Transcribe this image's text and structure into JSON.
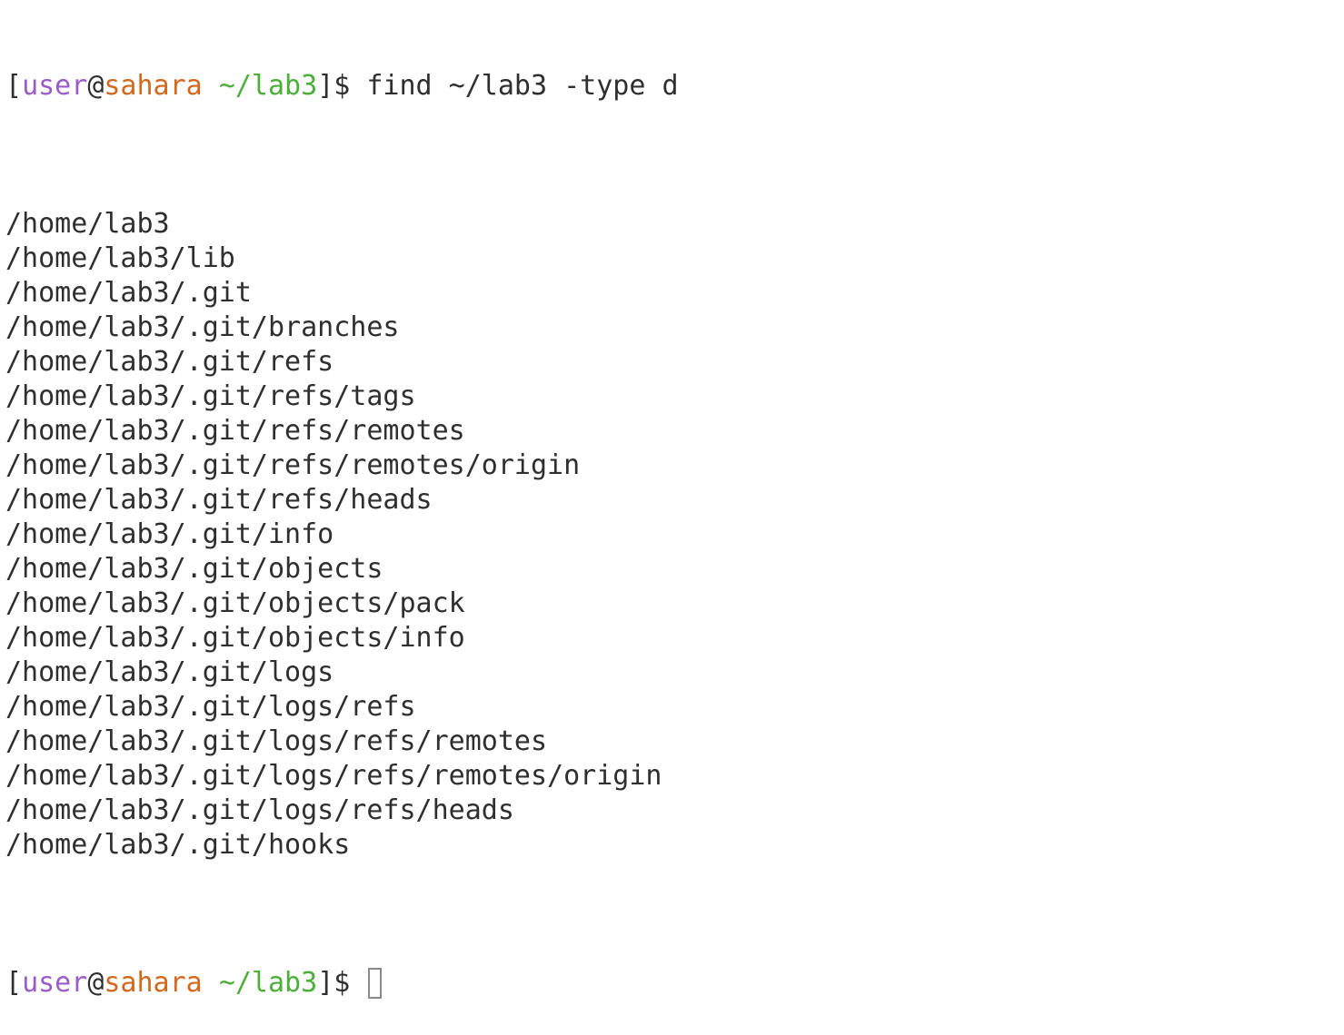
{
  "colors": {
    "text": "#2f2f2f",
    "user": "#9a5cc8",
    "host": "#d2691e",
    "path": "#4caf3a",
    "bracket": "#2f2f2f",
    "cursor": "#8a8a8a"
  },
  "prompt1": {
    "open_bracket": "[",
    "user": "user",
    "at": "@",
    "host": "sahara",
    "space": " ",
    "cwd": "~/lab3",
    "close": "]$ ",
    "command": "find ~/lab3 -type d"
  },
  "output": [
    "/home/lab3",
    "/home/lab3/lib",
    "/home/lab3/.git",
    "/home/lab3/.git/branches",
    "/home/lab3/.git/refs",
    "/home/lab3/.git/refs/tags",
    "/home/lab3/.git/refs/remotes",
    "/home/lab3/.git/refs/remotes/origin",
    "/home/lab3/.git/refs/heads",
    "/home/lab3/.git/info",
    "/home/lab3/.git/objects",
    "/home/lab3/.git/objects/pack",
    "/home/lab3/.git/objects/info",
    "/home/lab3/.git/logs",
    "/home/lab3/.git/logs/refs",
    "/home/lab3/.git/logs/refs/remotes",
    "/home/lab3/.git/logs/refs/remotes/origin",
    "/home/lab3/.git/logs/refs/heads",
    "/home/lab3/.git/hooks"
  ],
  "prompt2": {
    "open_bracket": "[",
    "user": "user",
    "at": "@",
    "host": "sahara",
    "space": " ",
    "cwd": "~/lab3",
    "close": "]$ "
  }
}
